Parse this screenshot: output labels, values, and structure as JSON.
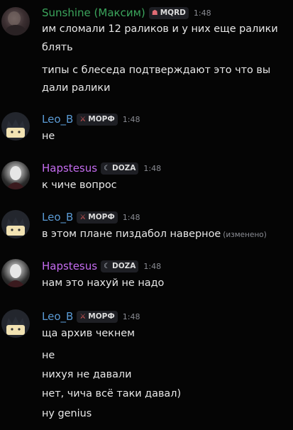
{
  "messages": [
    {
      "author": "Sunshine (Максим)",
      "author_color": "#3ba55c",
      "avatar": "dark-photo-avatar",
      "tag_icon": "heart-shield-icon",
      "tag": "MQRD",
      "time": "1:48",
      "lines": [
        "им сломали 12 раликов и у них еще ралики",
        "блять",
        "типы с блеседа подтверждают это что вы",
        "дали ралики"
      ]
    },
    {
      "author": "Leo_B",
      "author_color": "#5b9bd5",
      "avatar": "cat-avatar",
      "tag_icon": "swords-icon",
      "tag": "МОРФ",
      "time": "1:48",
      "lines": [
        "не"
      ]
    },
    {
      "author": "Hapstesus",
      "author_color": "#c56cf0",
      "avatar": "hooded-figure-avatar",
      "tag_icon": "moon-icon",
      "tag": "DOZA",
      "time": "1:48",
      "lines": [
        "к чиче вопрос"
      ]
    },
    {
      "author": "Leo_B",
      "author_color": "#5b9bd5",
      "avatar": "cat-avatar",
      "tag_icon": "swords-icon",
      "tag": "МОРФ",
      "time": "1:48",
      "lines": [
        "в этом плане пиздабол наверное"
      ],
      "edited": "(изменено)"
    },
    {
      "author": "Hapstesus",
      "author_color": "#c56cf0",
      "avatar": "hooded-figure-avatar",
      "tag_icon": "moon-icon",
      "tag": "DOZA",
      "time": "1:48",
      "lines": [
        "нам это нахуй не надо"
      ]
    },
    {
      "author": "Leo_B",
      "author_color": "#5b9bd5",
      "avatar": "cat-avatar",
      "tag_icon": "swords-icon",
      "tag": "МОРФ",
      "time": "1:48",
      "lines": [
        "ща архив чекнем",
        "не",
        "нихуя не давали",
        "нет, чича всё таки давал)",
        "ну genius"
      ]
    }
  ]
}
